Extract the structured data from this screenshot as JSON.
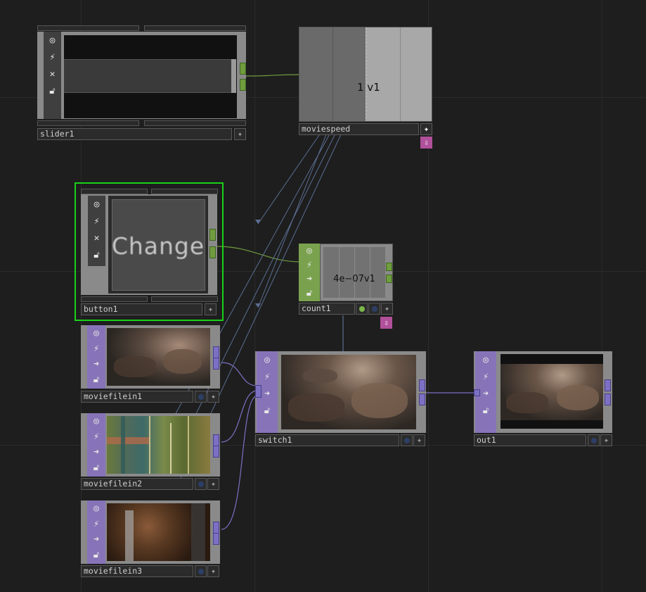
{
  "colors": {
    "background": "#1e1e1e",
    "chop_port": "#6f9c3e",
    "top_port": "#7c70c4",
    "selected_border": "#19d019",
    "operator_flag": "#b0509a"
  },
  "nodes": {
    "slider1": {
      "name": "slider1"
    },
    "moviespeed": {
      "name": "moviespeed",
      "value_text": "1 v1"
    },
    "button1": {
      "name": "button1",
      "button_text": "Change",
      "selected": true
    },
    "count1": {
      "name": "count1",
      "value_text": "4e−07v1"
    },
    "moviefilein1": {
      "name": "moviefilein1"
    },
    "moviefilein2": {
      "name": "moviefilein2"
    },
    "moviefilein3": {
      "name": "moviefilein3"
    },
    "switch1": {
      "name": "switch1"
    },
    "out1": {
      "name": "out1"
    }
  },
  "icons": {
    "viewer": "viewer-active-icon",
    "bypass": "bypass-icon",
    "cook": "cook-icon",
    "lock": "lock-icon",
    "close": "close-icon",
    "display": "display-flag-icon",
    "render": "render-flag-icon"
  }
}
